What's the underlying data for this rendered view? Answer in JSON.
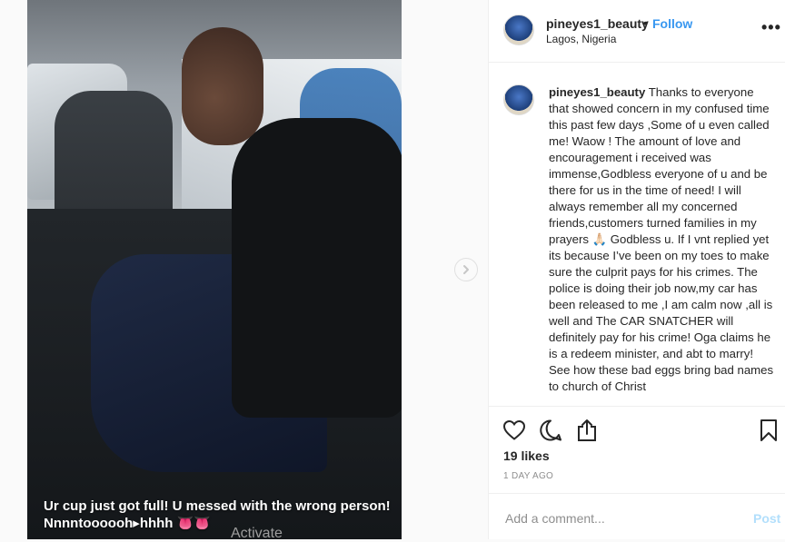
{
  "photo": {
    "caption": "Ur cup just got full! U messed with the wrong person! Nnnntoooooh▸hhhh 👅👅"
  },
  "header": {
    "username": "pineyes1_beauty",
    "separator": "•",
    "follow_label": "Follow",
    "location": "Lagos, Nigeria",
    "more_label": "•••"
  },
  "comment": {
    "username": "pineyes1_beauty",
    "text": "Thanks to everyone that showed concern in my confused time this past few days ,Some of u even called me! Waow ! The amount of love and encouragement i received was immense,Godbless everyone of u and be there for us in the time of need! I will always remember all my concerned friends,customers turned families in my prayers 🙏🏻 Godbless u. If I vnt replied yet its because I’ve been on my toes to make sure the culprit pays for his crimes. The police is doing their job now,my car has been released to me ,I am calm now ,all is well and The CAR SNATCHER will definitely pay for his crime! Oga claims he is a redeem minister, and abt to marry! See how these bad eggs bring bad names to church of Christ"
  },
  "actions": {
    "icons": [
      "heart-icon",
      "comment-icon",
      "share-icon",
      "bookmark-icon"
    ],
    "likes": "19 likes",
    "date": "1 DAY AGO"
  },
  "add_comment": {
    "placeholder": "Add a comment...",
    "post_label": "Post"
  },
  "watermark": "Activate",
  "colors": {
    "accent": "#3897f0",
    "post_disabled": "#b2dffc",
    "border": "#efefef"
  }
}
